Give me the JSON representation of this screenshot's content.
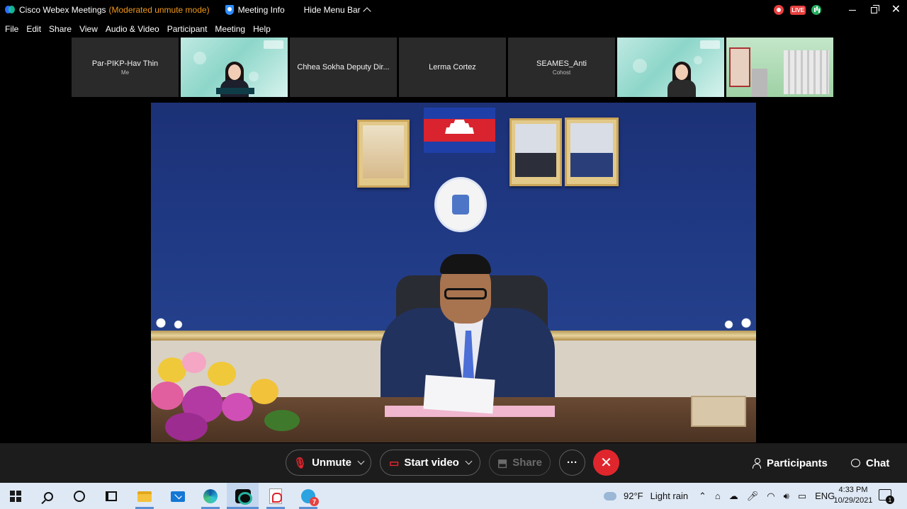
{
  "titlebar": {
    "app_title": "Cisco Webex Meetings",
    "mode": "(Moderated unmute mode)",
    "meeting_info": "Meeting Info",
    "hide_menu_bar": "Hide Menu Bar",
    "live_badge": "LIVE"
  },
  "menu": [
    "File",
    "Edit",
    "Share",
    "View",
    "Audio & Video",
    "Participant",
    "Meeting",
    "Help"
  ],
  "thumbnails": [
    {
      "name": "Par-PIKP-Hav Thin",
      "role": "Me",
      "type": "name"
    },
    {
      "name": "",
      "role": "",
      "type": "video"
    },
    {
      "name": "Chhea Sokha Deputy Dir...",
      "role": "",
      "type": "name"
    },
    {
      "name": "Lerma Cortez",
      "role": "",
      "type": "name"
    },
    {
      "name": "SEAMES_Anti",
      "role": "Cohost",
      "type": "name"
    },
    {
      "name": "",
      "role": "",
      "type": "video"
    },
    {
      "name": "",
      "role": "",
      "type": "video"
    }
  ],
  "controls": {
    "unmute": "Unmute",
    "start_video": "Start video",
    "share": "Share",
    "more": "···",
    "end": "✕",
    "participants": "Participants",
    "chat": "Chat"
  },
  "taskbar": {
    "telegram_badge": "7",
    "weather_temp": "92°F",
    "weather_desc": "Light rain",
    "language": "ENG",
    "time": "4:33 PM",
    "date": "10/29/2021",
    "notification_count": "1"
  },
  "colors": {
    "accent_orange": "#f29a1a",
    "end_red": "#e0262d",
    "wall_blue": "#1c3176",
    "taskbar_bg": "#dfe9f5"
  }
}
